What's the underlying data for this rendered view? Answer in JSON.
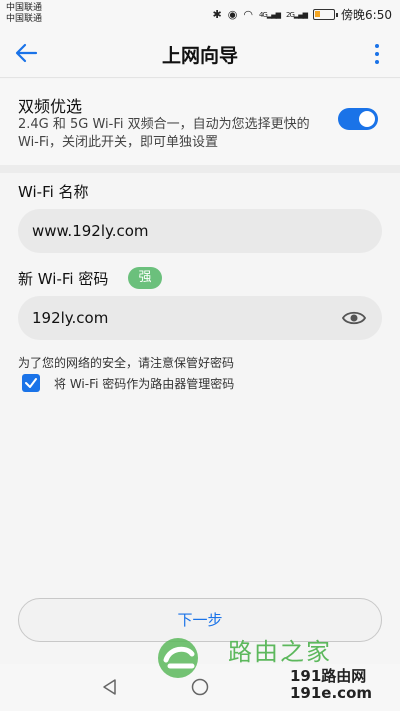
{
  "status_bar": {
    "carrier1": "中国联通",
    "carrier2": "中国联通",
    "time": "傍晚6:50",
    "net1": "4G",
    "net2": "2G"
  },
  "header": {
    "title": "上网向导"
  },
  "dual_band": {
    "title": "双频优选",
    "desc": "2.4G 和 5G Wi-Fi 双频合一，自动为您选择更快的 Wi-Fi，关闭此开关，即可单独设置",
    "enabled": true
  },
  "wifi_name": {
    "label": "Wi-Fi 名称",
    "value": "www.192ly.com"
  },
  "wifi_password": {
    "label": "新 Wi-Fi 密码",
    "strength": "强",
    "value": "192ly.com"
  },
  "note": "为了您的网络的安全，请注意保管好密码",
  "checkbox": {
    "label": "将 Wi-Fi 密码作为路由器管理密码",
    "checked": true
  },
  "next_button": "下一步",
  "watermark": {
    "text1": "路由之家",
    "text2a": "191路由网",
    "text2b": "191e.com"
  },
  "colors": {
    "accent": "#1a73e8",
    "strength": "#6bc07c",
    "watermark": "#5cb85c"
  }
}
